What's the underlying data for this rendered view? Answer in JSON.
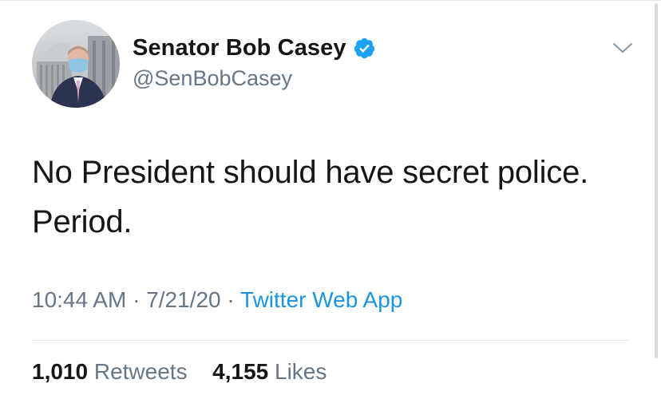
{
  "author": {
    "display_name": "Senator Bob Casey",
    "handle": "@SenBobCasey",
    "verified": true,
    "verified_icon": "verified-badge-icon",
    "avatar_icon": "profile-photo"
  },
  "menu": {
    "icon": "chevron-down-icon"
  },
  "tweet": {
    "text": "No President should have secret police. Period."
  },
  "meta": {
    "time": "10:44 AM",
    "separator": "·",
    "date": "7/21/20",
    "source": "Twitter Web App"
  },
  "stats": {
    "retweets_count": "1,010",
    "retweets_label": "Retweets",
    "likes_count": "4,155",
    "likes_label": "Likes"
  },
  "colors": {
    "text_primary": "#14171a",
    "text_secondary": "#657786",
    "link": "#1b95e0",
    "verified": "#1da1f2",
    "divider": "#e1e8ed"
  }
}
